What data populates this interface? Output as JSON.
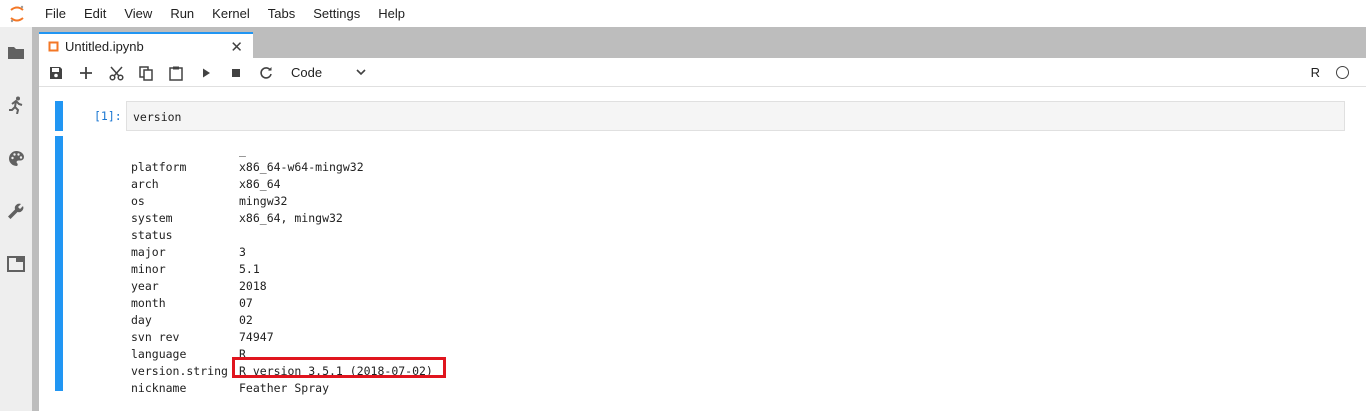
{
  "menubar": {
    "items": [
      "File",
      "Edit",
      "View",
      "Run",
      "Kernel",
      "Tabs",
      "Settings",
      "Help"
    ]
  },
  "sidebar": {
    "icons": [
      "folder-icon",
      "running-icon",
      "palette-icon",
      "wrench-icon",
      "tabs-icon"
    ]
  },
  "tab": {
    "label": "Untitled.ipynb"
  },
  "toolbar": {
    "cell_type": "Code",
    "kernel_name": "R"
  },
  "cells": {
    "input": {
      "prompt": "[1]:",
      "code": "version"
    },
    "output": {
      "header_underscore": "_",
      "rows": [
        {
          "key": "platform",
          "value": "x86_64-w64-mingw32"
        },
        {
          "key": "arch",
          "value": "x86_64"
        },
        {
          "key": "os",
          "value": "mingw32"
        },
        {
          "key": "system",
          "value": "x86_64, mingw32"
        },
        {
          "key": "status",
          "value": ""
        },
        {
          "key": "major",
          "value": "3"
        },
        {
          "key": "minor",
          "value": "5.1"
        },
        {
          "key": "year",
          "value": "2018"
        },
        {
          "key": "month",
          "value": "07"
        },
        {
          "key": "day",
          "value": "02"
        },
        {
          "key": "svn rev",
          "value": "74947"
        },
        {
          "key": "language",
          "value": "R"
        },
        {
          "key": "version.string",
          "value": "R version 3.5.1 (2018-07-02)"
        },
        {
          "key": "nickname",
          "value": "Feather Spray"
        }
      ]
    }
  },
  "colors": {
    "accent": "#2196f3",
    "highlight_box": "#e0151e",
    "logo_orange": "#f37726"
  }
}
